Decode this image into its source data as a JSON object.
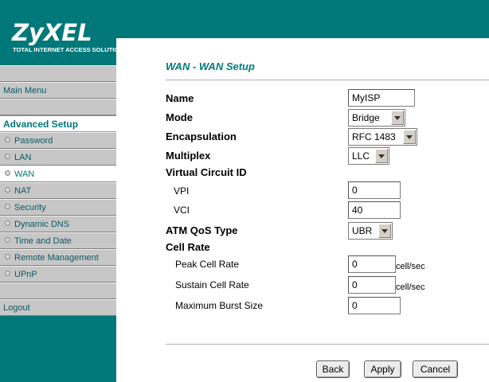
{
  "brand": {
    "name": "ZyXEL",
    "tagline_words": [
      "TOTAL",
      "INTERNET",
      "ACCESS",
      "SOLUTION"
    ]
  },
  "sidebar": {
    "main_menu": "Main Menu",
    "section_title": "Advanced Setup",
    "items": [
      {
        "label": "Password"
      },
      {
        "label": "LAN"
      },
      {
        "label": "WAN"
      },
      {
        "label": "NAT"
      },
      {
        "label": "Security"
      },
      {
        "label": "Dynamic DNS"
      },
      {
        "label": "Time and Date"
      },
      {
        "label": "Remote Management"
      },
      {
        "label": "UPnP"
      }
    ],
    "logout": "Logout"
  },
  "page": {
    "title": "WAN - WAN Setup"
  },
  "form": {
    "name": {
      "label": "Name",
      "value": "MyISP"
    },
    "mode": {
      "label": "Mode",
      "value": "Bridge"
    },
    "encapsulation": {
      "label": "Encapsulation",
      "value": "RFC 1483"
    },
    "multiplex": {
      "label": "Multiplex",
      "value": "LLC"
    },
    "vc_heading": "Virtual Circuit ID",
    "vpi": {
      "label": "VPI",
      "value": "0"
    },
    "vci": {
      "label": "VCI",
      "value": "40"
    },
    "atm_qos": {
      "label": "ATM QoS Type",
      "value": "UBR"
    },
    "cell_rate_heading": "Cell Rate",
    "peak_cell_rate": {
      "label": "Peak Cell Rate",
      "value": "0",
      "unit": "cell/sec"
    },
    "sustain_cell_rate": {
      "label": "Sustain Cell Rate",
      "value": "0",
      "unit": "cell/sec"
    },
    "max_burst_size": {
      "label": "Maximum Burst Size",
      "value": "0"
    }
  },
  "buttons": {
    "back": "Back",
    "apply": "Apply",
    "cancel": "Cancel"
  },
  "colors": {
    "teal": "#00787a",
    "nav_gray": "#c7c7c7",
    "nav_text": "#0a5a66"
  }
}
